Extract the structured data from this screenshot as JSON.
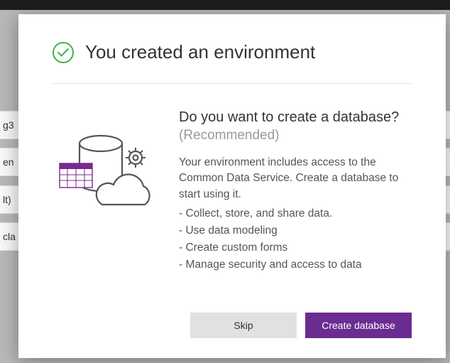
{
  "bgRows": [
    "g3",
    "en",
    "lt)",
    "cla"
  ],
  "dialog": {
    "title": "You created an environment",
    "question": "Do you want to create a database?",
    "recommended": "(Recommended)",
    "description": "Your environment includes access to the Common Data Service. Create a database to start using it.",
    "bullets": [
      "- Collect, store, and share data.",
      "- Use data modeling",
      "- Create custom forms",
      "- Manage security and access to data"
    ],
    "skip_label": "Skip",
    "create_label": "Create database"
  }
}
